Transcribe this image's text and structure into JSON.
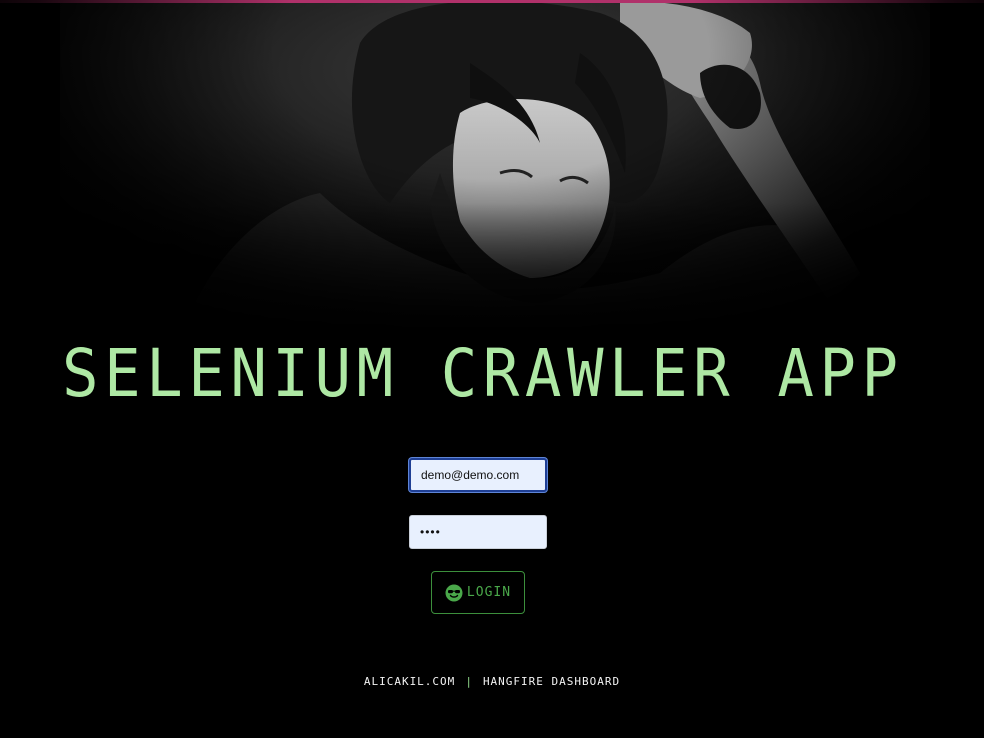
{
  "header": {
    "accent_color": "#b0316a",
    "hero_image": "portrait-photo"
  },
  "app": {
    "title": "SELENIUM CRAWLER APP",
    "title_color": "#aee8a4"
  },
  "login_form": {
    "email_value": "demo@demo.com",
    "password_value": "demo",
    "login_label": "LOGIN",
    "login_icon": "smile-sunglasses-icon",
    "button_color": "#4aa84a"
  },
  "footer": {
    "link1": "ALICAKIL.COM",
    "separator": "|",
    "link2": "HANGFIRE DASHBOARD"
  }
}
